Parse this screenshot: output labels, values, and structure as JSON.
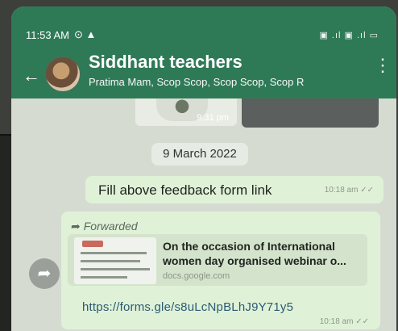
{
  "status_bar": {
    "time": "11:53 AM",
    "icons_text": "▣ .ıl ▣ .ıl ▭"
  },
  "header": {
    "back_icon": "arrow-left-icon",
    "title": "Siddhant teachers",
    "subtitle": "Pratima Mam, Scop Scop, Scop Scop, Scop R",
    "menu_icon": "more-vert-icon"
  },
  "chat": {
    "media_time": "9:31 pm",
    "date_chip": "9 March 2022",
    "messages": [
      {
        "text": "Fill above feedback form link",
        "time": "10:18 am"
      },
      {
        "forwarded_label": "Forwarded",
        "preview": {
          "title": "On the occasion of International women day organised webinar o...",
          "domain": "docs.google.com"
        },
        "link": "https://forms.gle/s8uLcNpBLhJ9Y71y5",
        "time": "10:18 am"
      }
    ]
  },
  "colors": {
    "header_bg": "#2f7a56",
    "chat_bg": "#d6dbd2",
    "bubble_bg": "#dff2d7",
    "link_color": "#2c5a74"
  }
}
